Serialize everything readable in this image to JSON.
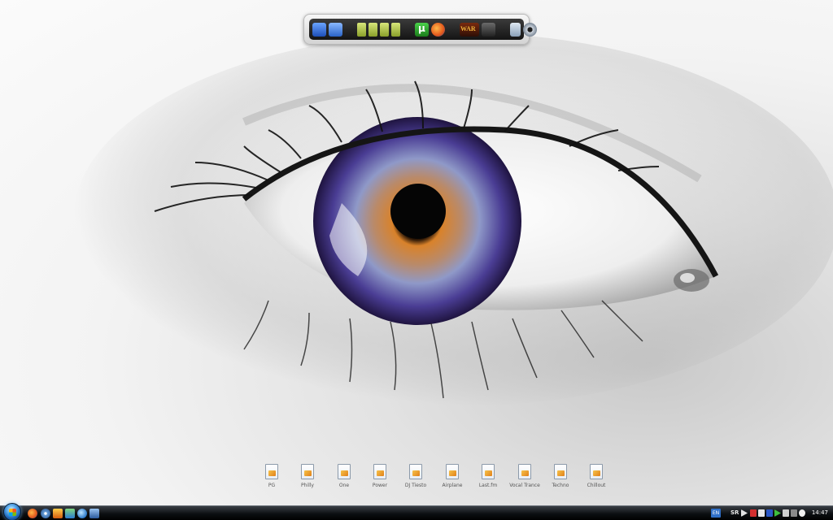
{
  "dock": {
    "items": [
      {
        "name": "computer"
      },
      {
        "name": "network"
      },
      {
        "name": "folder-1"
      },
      {
        "name": "folder-2"
      },
      {
        "name": "folder-3"
      },
      {
        "name": "folder-4"
      },
      {
        "name": "utorrent"
      },
      {
        "name": "firefox"
      },
      {
        "name": "warhammer-online"
      },
      {
        "name": "game-shield"
      },
      {
        "name": "recycle-bin"
      },
      {
        "name": "settings"
      }
    ]
  },
  "desktop_icons": [
    {
      "label": "PG"
    },
    {
      "label": "Philly"
    },
    {
      "label": "One"
    },
    {
      "label": "Power"
    },
    {
      "label": "DJ Tiesto"
    },
    {
      "label": "Airplane"
    },
    {
      "label": "Last.fm"
    },
    {
      "label": "Vocal Trance"
    },
    {
      "label": "Techno"
    },
    {
      "label": "Chillout"
    }
  ],
  "taskbar": {
    "quick_launch": [
      "firefox-icon",
      "media-player-icon",
      "flash-icon",
      "messenger-icon",
      "globe-icon",
      "show-desktop-icon"
    ],
    "tray": {
      "language": "EN",
      "region": "SR",
      "clock": "14:47"
    }
  }
}
